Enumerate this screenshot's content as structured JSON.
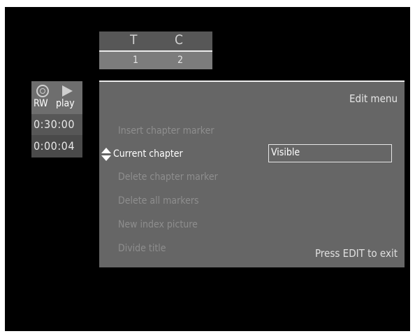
{
  "header": {
    "title_letter": "T",
    "chapter_letter": "C",
    "title_number": "1",
    "chapter_number": "2"
  },
  "status": {
    "disc_icon": "disc-icon",
    "play_icon": "play-icon",
    "disc_label": "RW",
    "mode_label": "play",
    "total_time": "0:30:00",
    "elapsed_time": "0:00:04"
  },
  "menu": {
    "title": "Edit menu",
    "items": [
      {
        "label": "Insert chapter marker"
      },
      {
        "label": "Current chapter"
      },
      {
        "label": "Delete chapter marker"
      },
      {
        "label": "Delete all markers"
      },
      {
        "label": "New index picture"
      },
      {
        "label": "Divide title"
      }
    ],
    "selected_index": 1,
    "current_value": "Visible",
    "hint": "Press EDIT to exit"
  },
  "colors": {
    "background": "#000000",
    "panel": "#666666",
    "highlight": "#ffffff",
    "disabled_text": "#8e8e8e"
  }
}
